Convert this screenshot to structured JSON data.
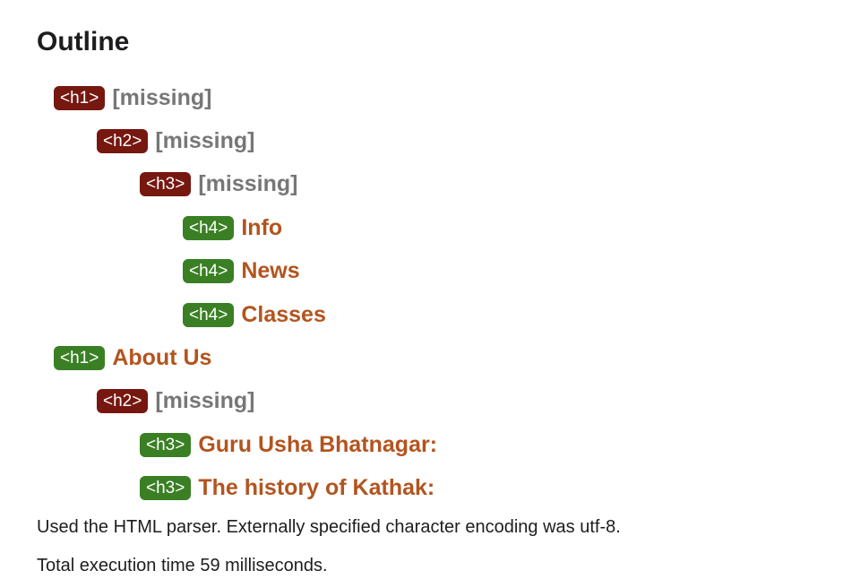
{
  "title": "Outline",
  "outline": [
    {
      "tag": "<h1>",
      "text": "[missing]",
      "level": 1,
      "status": "missing"
    },
    {
      "tag": "<h2>",
      "text": "[missing]",
      "level": 2,
      "status": "missing"
    },
    {
      "tag": "<h3>",
      "text": "[missing]",
      "level": 3,
      "status": "missing"
    },
    {
      "tag": "<h4>",
      "text": "Info",
      "level": 4,
      "status": "present"
    },
    {
      "tag": "<h4>",
      "text": "News",
      "level": 4,
      "status": "present"
    },
    {
      "tag": "<h4>",
      "text": "Classes",
      "level": 4,
      "status": "present"
    },
    {
      "tag": "<h1>",
      "text": "About Us",
      "level": 1,
      "status": "present"
    },
    {
      "tag": "<h2>",
      "text": "[missing]",
      "level": 2,
      "status": "missing"
    },
    {
      "tag": "<h3>",
      "text": "Guru Usha Bhatnagar:",
      "level": 3,
      "status": "present"
    },
    {
      "tag": "<h3>",
      "text": "The history of Kathak:",
      "level": 3,
      "status": "present"
    }
  ],
  "footer": {
    "parser_note": "Used the HTML parser. Externally specified character encoding was utf-8.",
    "timing": "Total execution time 59 milliseconds."
  },
  "colors": {
    "missing_badge": "#761710",
    "present_badge": "#3a7f24",
    "heading_text": "#b3541e",
    "missing_text": "#777777"
  }
}
